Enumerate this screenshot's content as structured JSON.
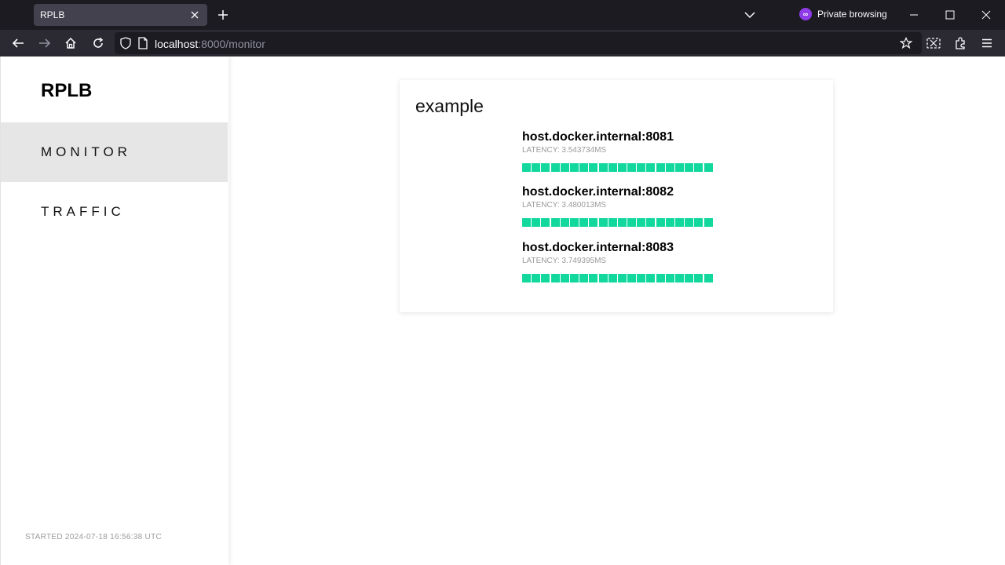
{
  "browser": {
    "tab_title": "RPLB",
    "private_label": "Private browsing",
    "url_host": "localhost",
    "url_rest": ":8000/monitor"
  },
  "sidebar": {
    "brand": "RPLB",
    "items": [
      {
        "label": "MONITOR",
        "active": true
      },
      {
        "label": "TRAFFIC",
        "active": false
      }
    ],
    "started": "STARTED 2024-07-18 16:56:38 UTC"
  },
  "card": {
    "title": "example",
    "hosts": [
      {
        "name": "host.docker.internal:8081",
        "latency": "LATENCY: 3.543734MS",
        "health_checks_ok": 20
      },
      {
        "name": "host.docker.internal:8082",
        "latency": "LATENCY: 3.480013MS",
        "health_checks_ok": 20
      },
      {
        "name": "host.docker.internal:8083",
        "latency": "LATENCY: 3.749395MS",
        "health_checks_ok": 20
      }
    ],
    "status_color": "#12d89e"
  }
}
